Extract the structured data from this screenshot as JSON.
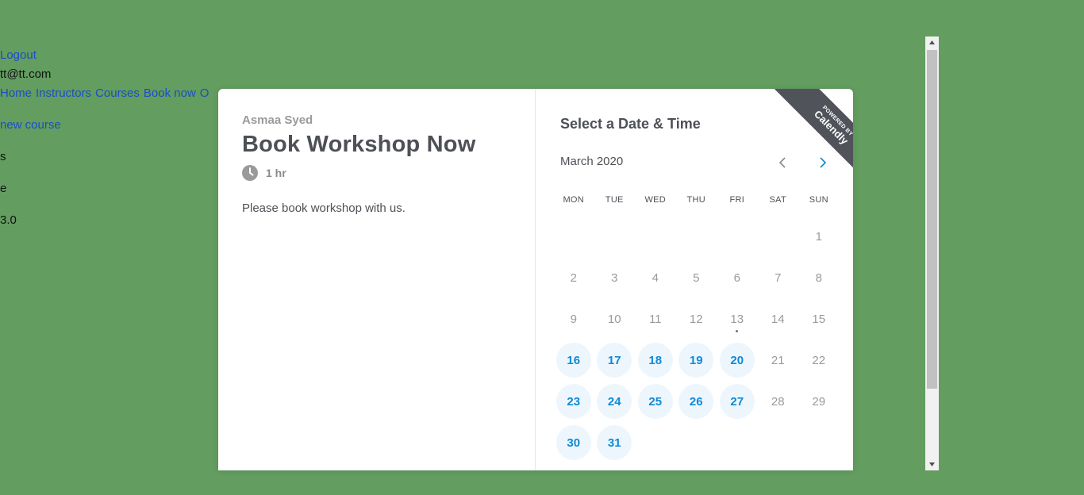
{
  "background_page": {
    "logout": "Logout",
    "user_email": "tt@tt.com",
    "nav": [
      "Home",
      "Instructors",
      "Courses",
      "Book now",
      "O"
    ],
    "new_course": "new course",
    "line_s": "s",
    "line_e": "e",
    "line_value": "3.0"
  },
  "scheduler": {
    "organizer": "Asmaa Syed",
    "event_title": "Book Workshop Now",
    "duration": "1 hr",
    "description": "Please book workshop with us.",
    "select_title": "Select a Date & Time",
    "month": "March 2020",
    "ribbon_small": "POWERED BY",
    "ribbon_big": "Calendly",
    "weekdays": [
      "MON",
      "TUE",
      "WED",
      "THU",
      "FRI",
      "SAT",
      "SUN"
    ],
    "weeks": [
      [
        null,
        null,
        null,
        null,
        null,
        null,
        1
      ],
      [
        2,
        3,
        4,
        5,
        6,
        7,
        8
      ],
      [
        9,
        10,
        11,
        12,
        13,
        14,
        15
      ],
      [
        16,
        17,
        18,
        19,
        20,
        21,
        22
      ],
      [
        23,
        24,
        25,
        26,
        27,
        28,
        29
      ],
      [
        30,
        31,
        null,
        null,
        null,
        null,
        null
      ]
    ],
    "available_days": [
      16,
      17,
      18,
      19,
      20,
      23,
      24,
      25,
      26,
      27,
      30,
      31
    ],
    "today": 13
  },
  "icons": {
    "clock": "clock-icon",
    "prev": "chevron-left-icon",
    "next": "chevron-right-icon"
  },
  "colors": {
    "page_background": "#639d60",
    "available_text": "#0d8ad6",
    "available_bg": "#eef6fd"
  }
}
